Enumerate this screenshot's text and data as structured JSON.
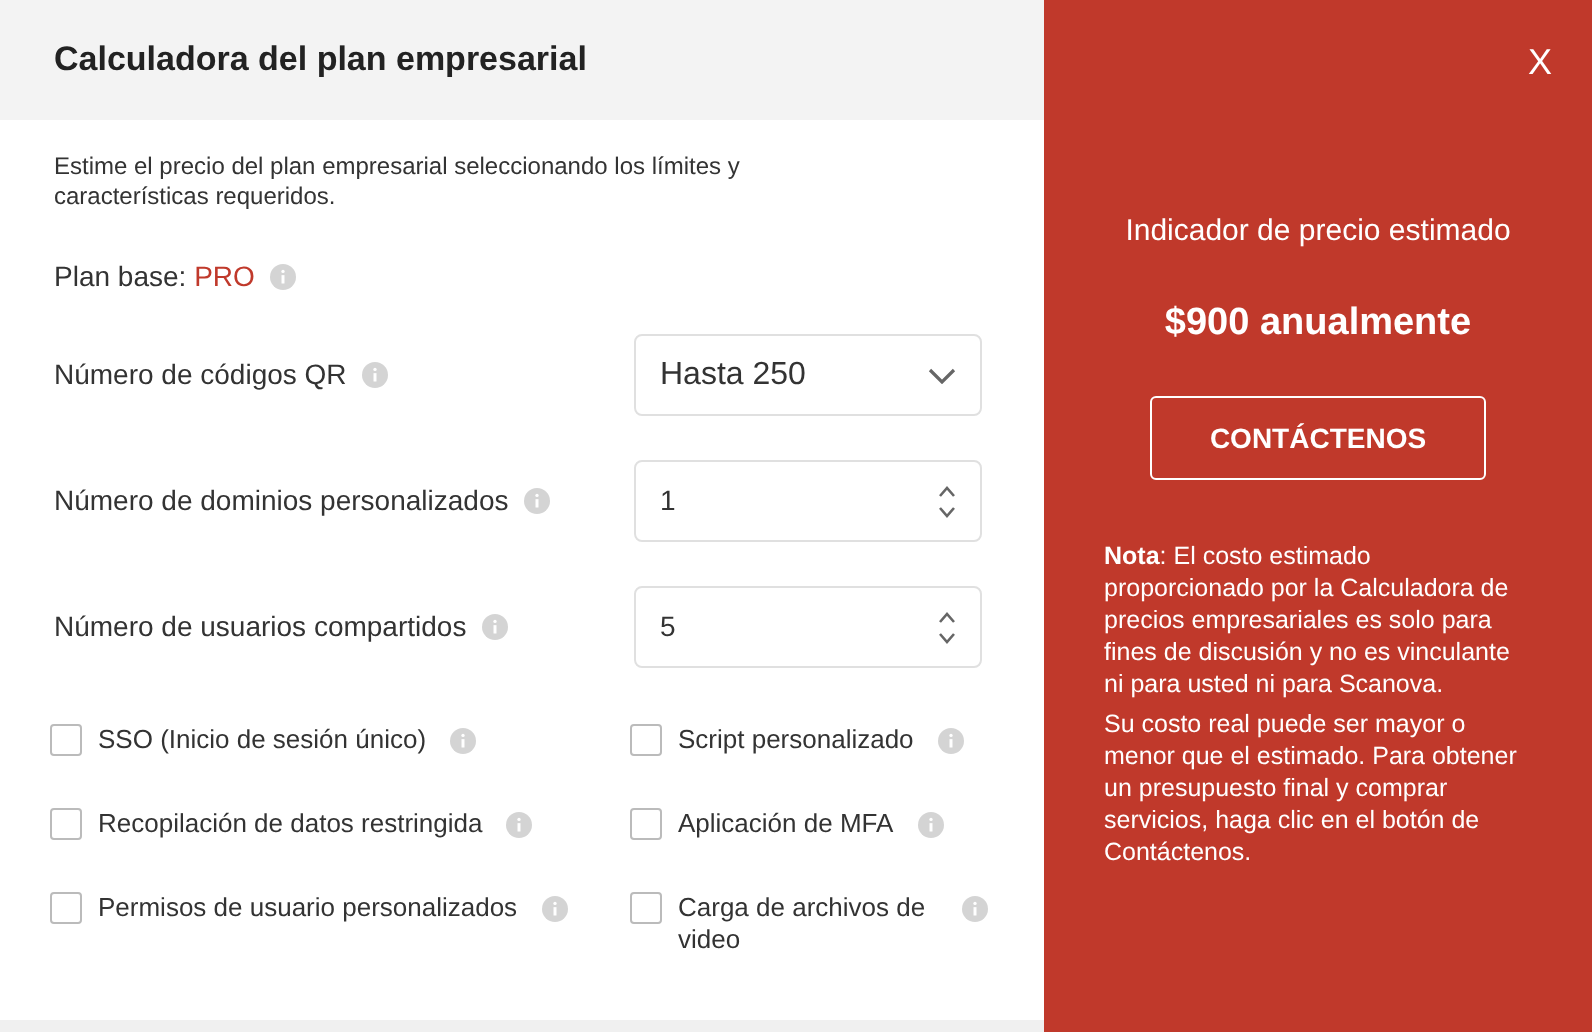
{
  "title": "Calculadora del plan empresarial",
  "intro": "Estime el precio del plan empresarial seleccionando los límites y características requeridos.",
  "plan": {
    "label": "Plan base:",
    "value": "PRO"
  },
  "fields": [
    {
      "label": "Número de códigos QR",
      "kind": "select",
      "value": "Hasta 250"
    },
    {
      "label": "Número de dominios personalizados",
      "kind": "number",
      "value": "1"
    },
    {
      "label": "Número de usuarios compartidos",
      "kind": "number",
      "value": "5"
    }
  ],
  "options": [
    {
      "label": "SSO (Inicio de sesión único)",
      "checked": false
    },
    {
      "label": "Script personalizado",
      "checked": false
    },
    {
      "label": "Recopilación de datos restringida",
      "checked": false
    },
    {
      "label": "Aplicación de MFA",
      "checked": false
    },
    {
      "label": "Permisos de usuario personalizados",
      "checked": false
    },
    {
      "label": "Carga de archivos de video",
      "checked": false
    }
  ],
  "summary": {
    "close": "X",
    "heading": "Indicador de precio estimado",
    "price": "$900 anualmente",
    "button": "CONTÁCTENOS",
    "note": "**Nota**: El costo estimado proporcionado por la Calculadora de precios empresariales es solo para fines de discusión y no es vinculante ni para usted ni para Scanova.",
    "note2": "Su costo real puede ser mayor o menor que el estimado. Para obtener un presupuesto final y comprar servicios, haga clic en el botón de Contáctenos."
  }
}
